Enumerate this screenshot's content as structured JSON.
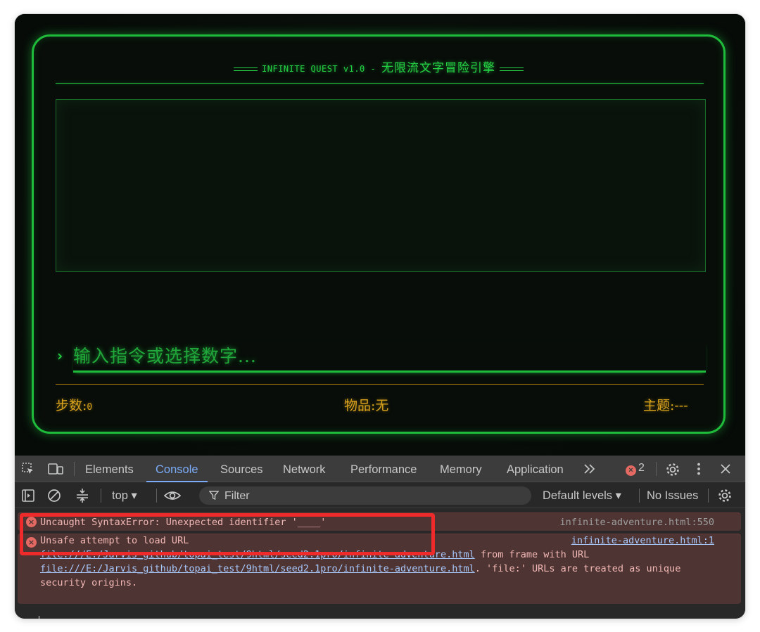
{
  "game": {
    "title_prefix": "INFINITE QUEST v1.0 - ",
    "title_cn": "无限流文字冒险引擎",
    "prompt_symbol": "›",
    "input_placeholder": "输入指令或选择数字...",
    "status": {
      "steps_label": "步数:",
      "steps_value": "0",
      "items_label": "物品:",
      "items_value": "无",
      "theme_label": "主题:",
      "theme_value": "---"
    },
    "colors": {
      "accent": "#1fbb3a",
      "status": "#d8a21c",
      "background": "#080d09"
    }
  },
  "devtools": {
    "tabs": [
      "Elements",
      "Console",
      "Sources",
      "Network",
      "Performance",
      "Memory",
      "Application"
    ],
    "active_tab": "Console",
    "more_tabs_icon": "chevron-double-right-icon",
    "error_count": "2",
    "toolbar": {
      "context": "top",
      "filter_placeholder": "Filter",
      "levels": "Default levels",
      "issues": "No Issues"
    },
    "messages": [
      {
        "text": "Uncaught SyntaxError: Unexpected identifier '____'",
        "source": "infinite-adventure.html:550"
      },
      {
        "line1": "Unsafe attempt to load URL",
        "url1": "file:///E:/Jarvis_github/topai_test/9html/seed2.1pro/infinite-adventure.html",
        "mid": " from frame with URL",
        "url2": "file:///E:/Jarvis_github/topai_test/9html/seed2.1pro/infinite-adventure.html",
        "tail": ". 'file:' URLs are treated as unique",
        "line4": "security origins.",
        "source": "infinite-adventure.html:1"
      }
    ],
    "prompt_symbol": "›"
  }
}
